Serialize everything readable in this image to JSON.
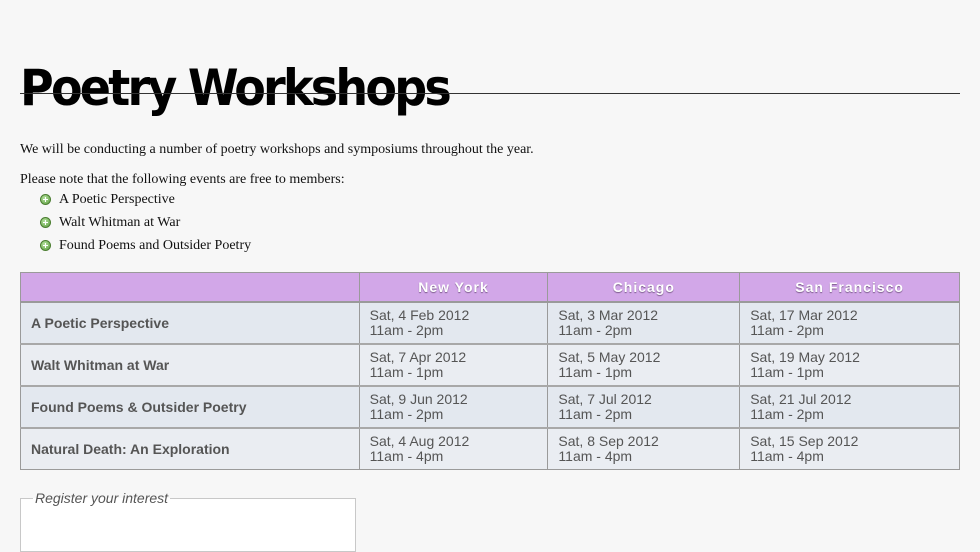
{
  "page": {
    "title": "Poetry Workshops",
    "intro": "We will be conducting a number of poetry workshops and symposiums throughout the year.",
    "note": "Please note that the following events are free to members:"
  },
  "free_events": [
    "A Poetic Perspective",
    "Walt Whitman at War",
    "Found Poems and Outsider Poetry"
  ],
  "schedule": {
    "header_color": "#d2a7e8",
    "columns": [
      "",
      "New York",
      "Chicago",
      "San Francisco"
    ],
    "rows": [
      {
        "event": "A Poetic Perspective",
        "slots": [
          {
            "date": "Sat, 4 Feb 2012",
            "time": "11am - 2pm"
          },
          {
            "date": "Sat, 3 Mar 2012",
            "time": "11am - 2pm"
          },
          {
            "date": "Sat, 17 Mar 2012",
            "time": "11am - 2pm"
          }
        ]
      },
      {
        "event": "Walt Whitman at War",
        "slots": [
          {
            "date": "Sat, 7 Apr 2012",
            "time": "11am - 1pm"
          },
          {
            "date": "Sat, 5 May 2012",
            "time": "11am - 1pm"
          },
          {
            "date": "Sat, 19 May 2012",
            "time": "11am - 1pm"
          }
        ]
      },
      {
        "event": "Found Poems & Outsider Poetry",
        "slots": [
          {
            "date": "Sat, 9 Jun 2012",
            "time": "11am - 2pm"
          },
          {
            "date": "Sat, 7 Jul 2012",
            "time": "11am - 2pm"
          },
          {
            "date": "Sat, 21 Jul 2012",
            "time": "11am - 2pm"
          }
        ]
      },
      {
        "event": "Natural Death: An Exploration",
        "slots": [
          {
            "date": "Sat, 4 Aug 2012",
            "time": "11am - 4pm"
          },
          {
            "date": "Sat, 8 Sep 2012",
            "time": "11am - 4pm"
          },
          {
            "date": "Sat, 15 Sep 2012",
            "time": "11am - 4pm"
          }
        ]
      }
    ]
  },
  "register": {
    "legend": "Register your interest"
  }
}
